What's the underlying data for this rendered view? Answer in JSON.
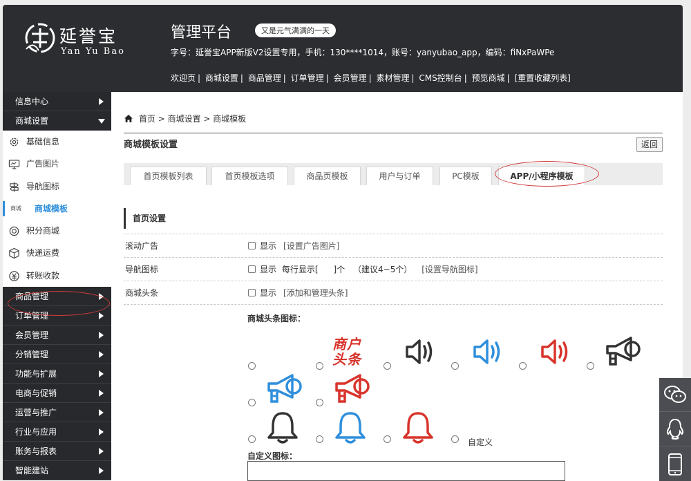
{
  "header": {
    "logo_cn": "延誉宝",
    "logo_en": "Yan Yu Bao",
    "title": "管理平台",
    "greeting": "又是元气满满的一天",
    "account_line": "字号：延誉宝APP新版V2设置专用，手机：130****1014，账号：yanyubao_app，编码：fiNxPaWPe",
    "nav": [
      "欢迎页",
      "商城设置",
      "商品管理",
      "订单管理",
      "会员管理",
      "素材管理",
      "CMS控制台",
      "预览商城",
      "[重置收藏列表]"
    ]
  },
  "sidebar": {
    "top_menus": [
      {
        "label": "信息中心",
        "expanded": false
      },
      {
        "label": "商城设置",
        "expanded": true
      }
    ],
    "sub_items": [
      {
        "label": "基础信息",
        "icon": "gear-icon"
      },
      {
        "label": "广告图片",
        "icon": "monitor-icon"
      },
      {
        "label": "导航图标",
        "icon": "navigation-icon"
      },
      {
        "label": "商城模板",
        "icon": "template-icon",
        "mini": "商城",
        "active": true
      },
      {
        "label": "积分商城",
        "icon": "points-icon"
      },
      {
        "label": "快递运费",
        "icon": "box-icon"
      },
      {
        "label": "转账收款",
        "icon": "money-icon"
      }
    ],
    "bottom_menus": [
      "商品管理",
      "订单管理",
      "会员管理",
      "分销管理",
      "功能与扩展",
      "电商与促销",
      "运营与推广",
      "行业与应用",
      "账务与报表",
      "智能建站"
    ]
  },
  "breadcrumb": {
    "home": "首页",
    "sep": ">",
    "level1": "商城设置",
    "level2": "商城模板"
  },
  "page": {
    "title": "商城模板设置",
    "back": "返回",
    "tabs": [
      "首页模板列表",
      "首页模板选项",
      "商品页模板",
      "用户与订单",
      "PC模板",
      "APP/小程序模板"
    ],
    "active_tab": 5,
    "section": "首页设置",
    "rows": [
      {
        "label": "滚动广告",
        "show": "显示",
        "link": "[设置广告图片]"
      },
      {
        "label": "导航图标",
        "show": "显示",
        "per_row": "每行显示[",
        "per_row_end": "]个",
        "hint": "（建议4~5个）",
        "link": "[设置导航图标]"
      },
      {
        "label": "商城头条",
        "show": "显示",
        "link": "[添加和管理头条]"
      }
    ],
    "icons_title": "商城头条图标：",
    "icon_text": "商户头条",
    "custom_label": "自定义",
    "custom_title": "自定义图标：",
    "custom_value": ""
  },
  "colors": {
    "red": "#d8342c",
    "blue": "#2f8fdc",
    "dark": "#2b2d30"
  }
}
